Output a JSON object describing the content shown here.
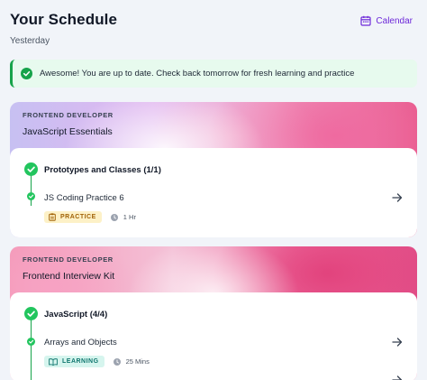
{
  "header": {
    "title": "Your Schedule",
    "subtitle": "Yesterday",
    "calendar_label": "Calendar"
  },
  "alert": {
    "message": "Awesome! You are up to date. Check back tomorrow for fresh learning and practice"
  },
  "colors": {
    "accent": "#6d28d9",
    "success": "#16a34a",
    "practice_badge": "#fdf1c7",
    "learning_badge": "#d6f5ee"
  },
  "cards": [
    {
      "track": "FRONTEND DEVELOPER",
      "course": "JavaScript Essentials",
      "section": "Prototypes and Classes (1/1)",
      "lesson": "JS Coding Practice 6",
      "badge": "PRACTICE",
      "badge_icon": "clipboard-icon",
      "duration": "1 Hr"
    },
    {
      "track": "FRONTEND DEVELOPER",
      "course": "Frontend Interview Kit",
      "section": "JavaScript (4/4)",
      "lesson": "Arrays and Objects",
      "badge": "LEARNING",
      "badge_icon": "book-icon",
      "duration": "25 Mins"
    }
  ]
}
